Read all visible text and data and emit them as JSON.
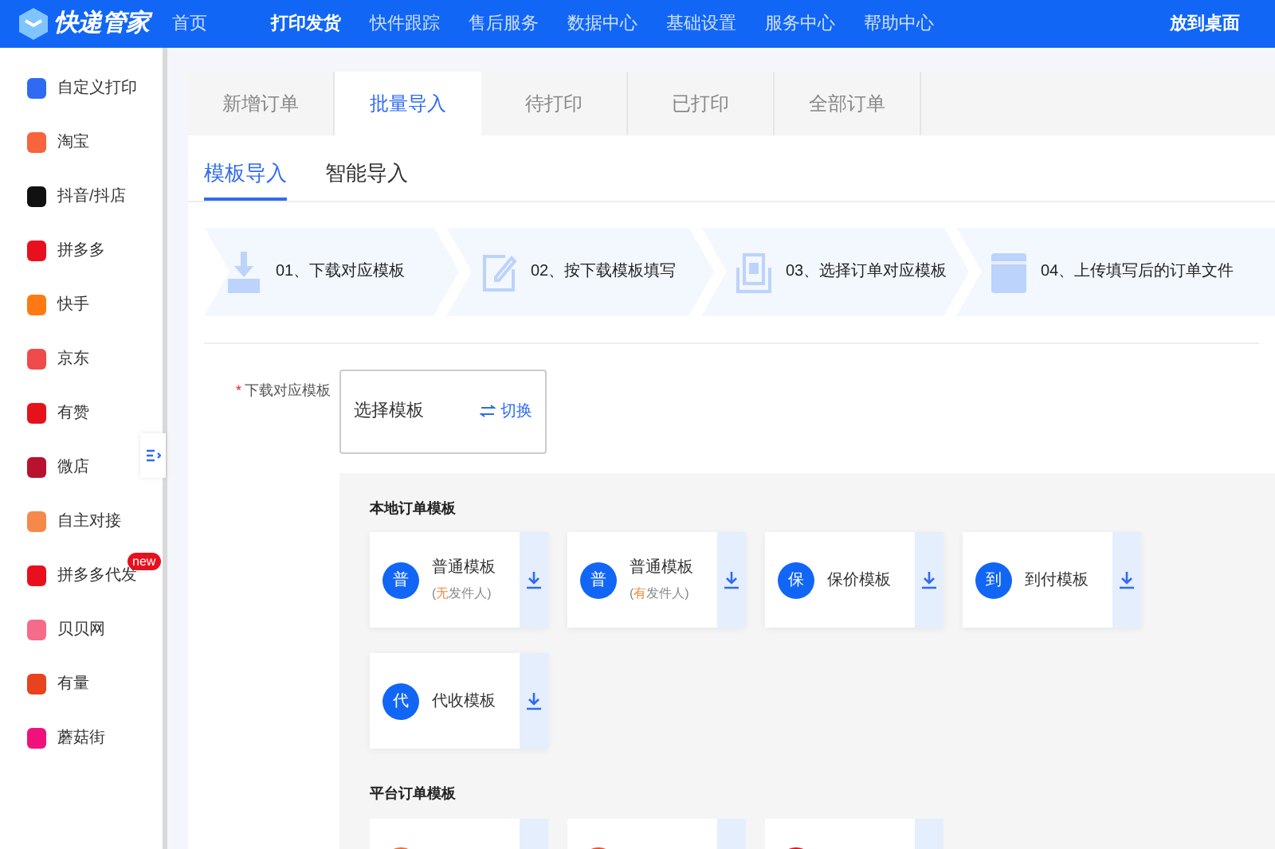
{
  "topbar": {
    "logo": "快递管家",
    "nav": [
      {
        "label": "首页",
        "selected": false
      },
      {
        "label": "打印发货",
        "selected": true
      },
      {
        "label": "快件跟踪",
        "selected": false
      },
      {
        "label": "售后服务",
        "selected": false
      },
      {
        "label": "数据中心",
        "selected": false
      },
      {
        "label": "基础设置",
        "selected": false
      },
      {
        "label": "服务中心",
        "selected": false
      },
      {
        "label": "帮助中心",
        "selected": false
      }
    ],
    "right_link": "放到桌面"
  },
  "sidebar": {
    "items": [
      {
        "label": "自定义打印",
        "color": "#2f6bf2"
      },
      {
        "label": "淘宝",
        "color": "#f8643c"
      },
      {
        "label": "抖音/抖店",
        "color": "#111111"
      },
      {
        "label": "拼多多",
        "color": "#e8101e"
      },
      {
        "label": "快手",
        "color": "#ff7a12"
      },
      {
        "label": "京东",
        "color": "#f04b4b"
      },
      {
        "label": "有赞",
        "color": "#e5121c"
      },
      {
        "label": "微店",
        "color": "#b8122e"
      },
      {
        "label": "自主对接",
        "color": "#f5894a"
      },
      {
        "label": "拼多多代发",
        "color": "#e8101e",
        "badge": "new"
      },
      {
        "label": "贝贝网",
        "color": "#f56b8a"
      },
      {
        "label": "有量",
        "color": "#e8421e"
      },
      {
        "label": "蘑菇街",
        "color": "#f0127a"
      }
    ]
  },
  "tabs": [
    {
      "label": "新增订单",
      "selected": false
    },
    {
      "label": "批量导入",
      "selected": true
    },
    {
      "label": "待打印",
      "selected": false
    },
    {
      "label": "已打印",
      "selected": false
    },
    {
      "label": "全部订单",
      "selected": false
    }
  ],
  "subtabs": [
    {
      "label": "模板导入",
      "selected": true
    },
    {
      "label": "智能导入",
      "selected": false
    }
  ],
  "steps": [
    {
      "label": "01、下载对应模板",
      "kind": "download"
    },
    {
      "label": "02、按下载模板填写",
      "kind": "edit"
    },
    {
      "label": "03、选择订单对应模板",
      "kind": "select"
    },
    {
      "label": "04、上传填写后的订单文件",
      "kind": "upload"
    }
  ],
  "form": {
    "required_mark": "*",
    "label": "下载对应模板",
    "select_value": "选择模板",
    "switch_label": "切换"
  },
  "local_section": {
    "title": "本地订单模板",
    "templates": [
      {
        "badge": "普",
        "name": "普通模板",
        "note": {
          "before": "(",
          "highlight": "无",
          "after": "发件人)"
        }
      },
      {
        "badge": "普",
        "name": "普通模板",
        "note": {
          "before": "(",
          "highlight": "有",
          "after": "发件人)"
        }
      },
      {
        "badge": "保",
        "name": "保价模板"
      },
      {
        "badge": "到",
        "name": "到付模板"
      },
      {
        "badge": "代",
        "name": "代收模板"
      }
    ]
  },
  "platform_section": {
    "title": "平台订单模板",
    "templates": [
      {
        "color": "#f26b2e"
      },
      {
        "color": "#f04b23"
      },
      {
        "color": "#e8101e"
      }
    ]
  }
}
